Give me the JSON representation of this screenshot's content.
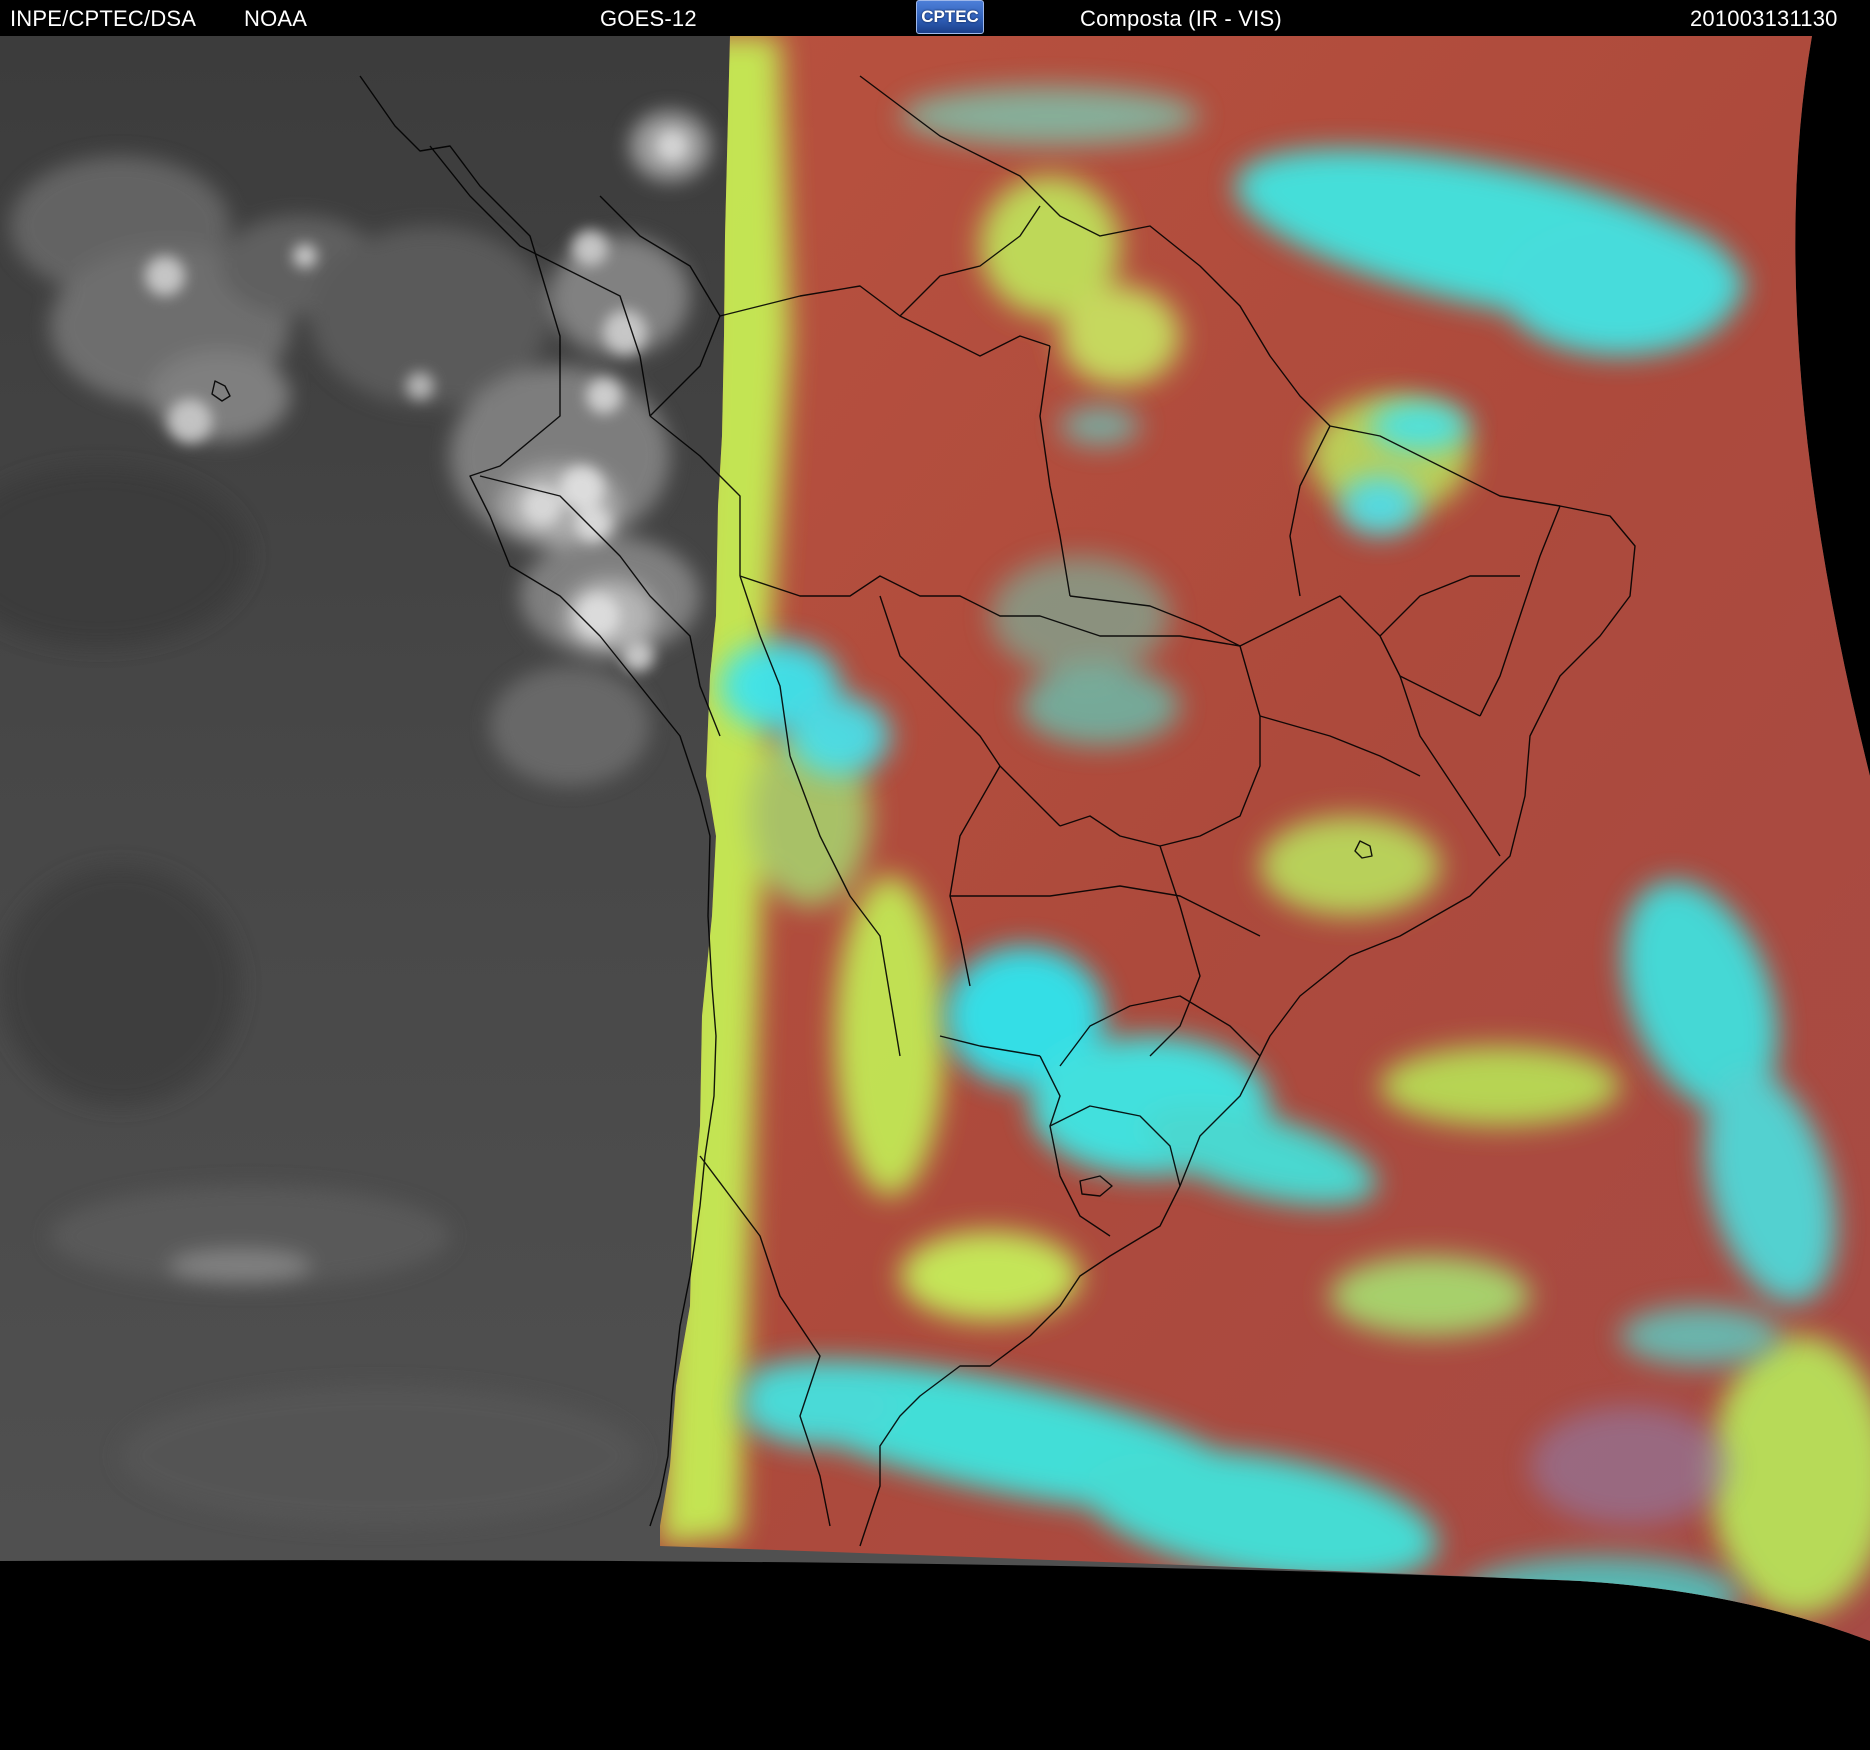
{
  "header": {
    "agency": "INPE/CPTEC/DSA",
    "provider": "NOAA",
    "satellite": "GOES-12",
    "logo_text": "CPTEC",
    "product": "Composta (IR - VIS)",
    "timestamp": "201003131130"
  },
  "colors": {
    "header_background": "#000000",
    "header_text": "#ffffff",
    "outside_scan": "#000000",
    "ir_ocean_gray": "#4a4a4a",
    "composite_land_red": "#b04a3c",
    "composite_cloud_cyan": "#37e8e8",
    "composite_low_cloud_yellow_green": "#c2e855",
    "boundary_lines": "#000000"
  }
}
